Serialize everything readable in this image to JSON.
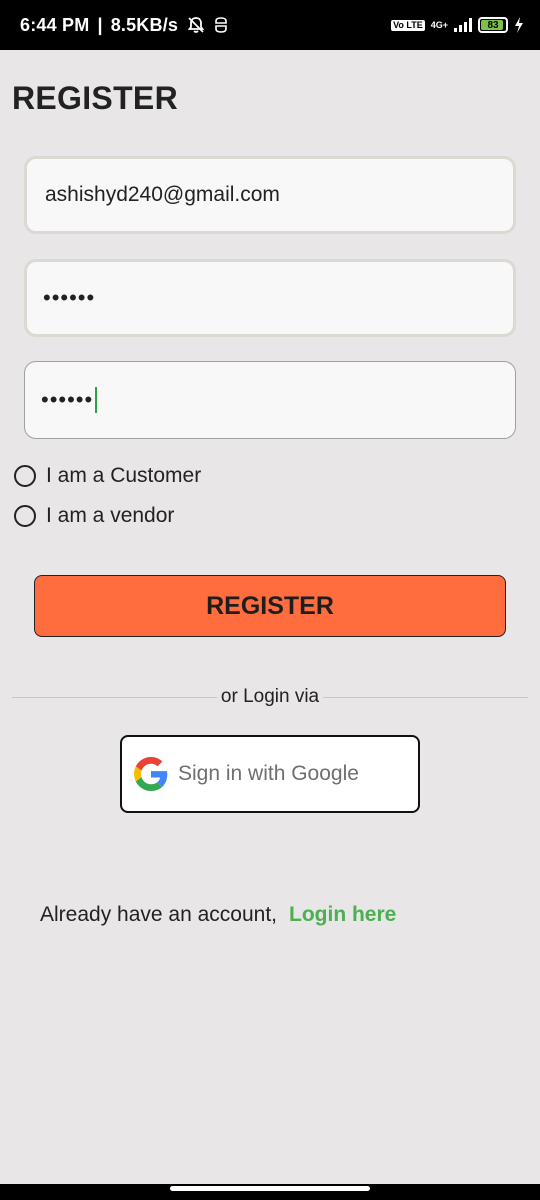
{
  "status_bar": {
    "time": "6:44 PM",
    "separator": "|",
    "speed": "8.5KB/s",
    "network_top": "Vo LTE",
    "network_gen": "4G+",
    "battery": "83"
  },
  "page": {
    "title": "REGISTER"
  },
  "form": {
    "email_value": "ashishyd240@gmail.com",
    "password_value": "••••••",
    "confirm_password_value": "••••••"
  },
  "roles": {
    "customer_label": "I am a Customer",
    "vendor_label": "I am a vendor"
  },
  "actions": {
    "register_label": "REGISTER",
    "divider_text": "or Login via",
    "google_label": "Sign in with Google"
  },
  "footer": {
    "prompt": "Already have an account,",
    "login_link": "Login here"
  },
  "colors": {
    "background": "#e8e6e6",
    "accent_button": "#ff6d3f",
    "link_green": "#4caf50",
    "cursor_green": "#2e9f44"
  }
}
